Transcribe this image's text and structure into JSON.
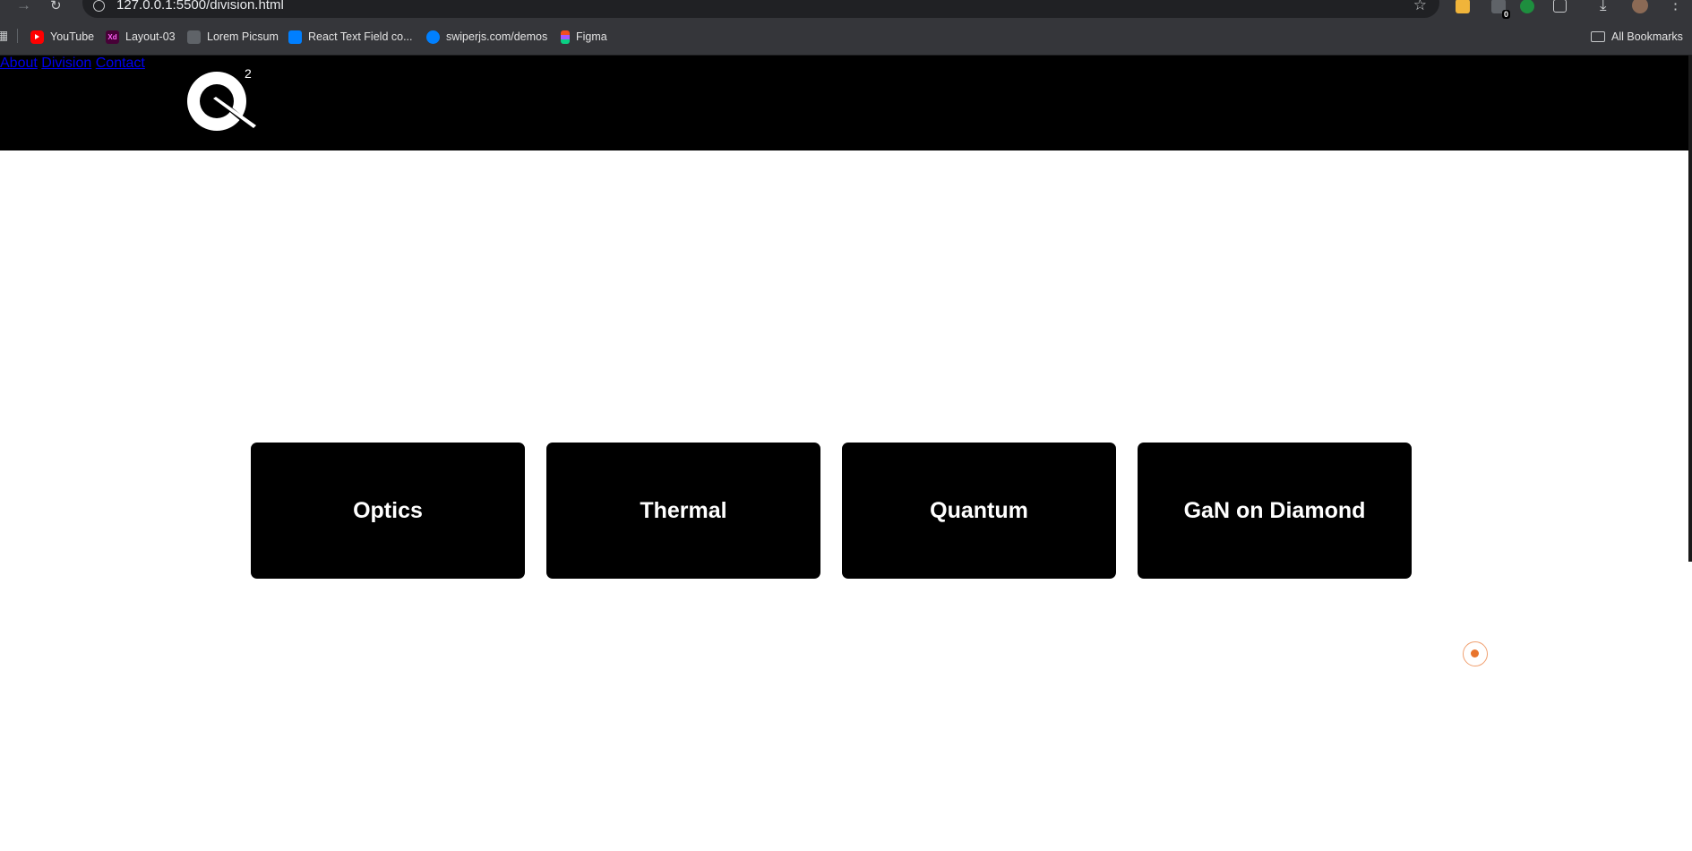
{
  "browser": {
    "url": "127.0.0.1:5500/division.html",
    "extension_badge": "0",
    "bookmarks": [
      {
        "label": "YouTube",
        "icon": "youtube-icon"
      },
      {
        "label": "Layout-03",
        "icon": "adobe-xd-icon"
      },
      {
        "label": "Lorem Picsum",
        "icon": "image-icon"
      },
      {
        "label": "React Text Field co...",
        "icon": "mui-icon"
      },
      {
        "label": "swiperjs.com/demos",
        "icon": "swiper-icon"
      },
      {
        "label": "Figma",
        "icon": "figma-icon"
      }
    ],
    "all_bookmarks_label": "All Bookmarks"
  },
  "header": {
    "logo_superscript": "2",
    "nav": [
      "About",
      "Division",
      "Contact"
    ]
  },
  "divisions": [
    "Optics",
    "Thermal",
    "Quantum",
    "GaN on Diamond"
  ],
  "colors": {
    "header_bg": "#000000",
    "card_bg": "#000000",
    "cursor_accent": "#e8742c"
  }
}
